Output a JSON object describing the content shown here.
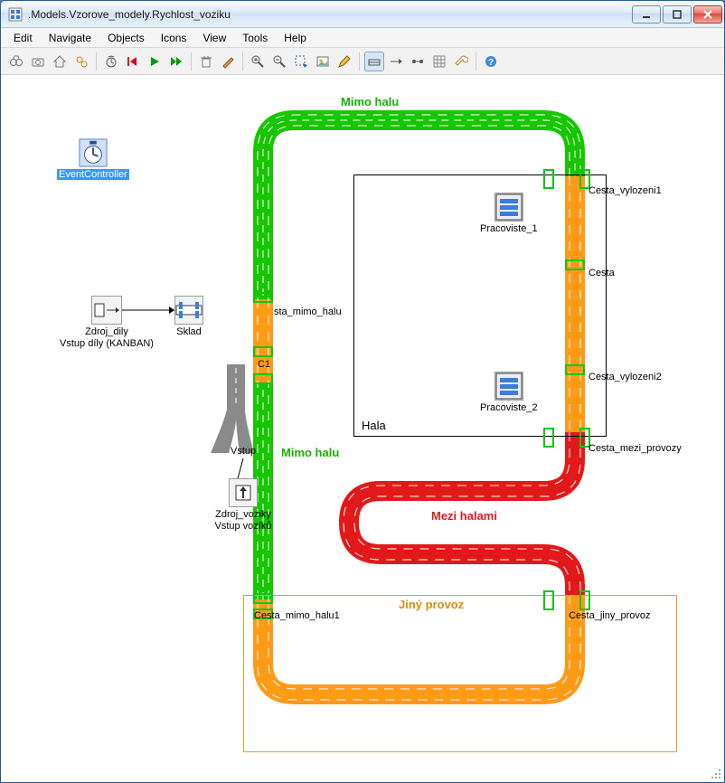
{
  "window": {
    "title": ".Models.Vzorove_modely.Rychlost_voziku"
  },
  "menu": {
    "edit": "Edit",
    "navigate": "Navigate",
    "objects": "Objects",
    "icons": "Icons",
    "view": "View",
    "tools": "Tools",
    "help": "Help"
  },
  "colors": {
    "green": "#17c600",
    "orange": "#ff9a17",
    "red": "#e31919"
  },
  "objects": {
    "event_controller": "EventController",
    "zdroj_dily": "Zdroj_dily\nVstup díly (KANBAN)",
    "sklad": "Sklad",
    "zdroj_voziky": "Zdroj_voziky\nVstup vozíků",
    "vstup": "Vstup",
    "pracoviste_1": "Pracoviste_1",
    "pracoviste_2": "Pracoviste_2",
    "hala_caption": "Hala"
  },
  "labels": {
    "sta_mimo_halu": "sta_mimo_halu",
    "c1": "C1",
    "cesta_vylozeni1": "Cesta_vylozeni1",
    "cesta": "Cesta",
    "cesta_vylozeni2": "Cesta_vylozeni2",
    "cesta_mezi_provozy": "Cesta_mezi_provozy",
    "cesta_mimo_halu1": "Cesta_mimo_halu1",
    "cesta_jiny_provoz": "Cesta_jiny_provoz",
    "mimo_halu_top": "Mimo halu",
    "mimo_halu_mid": "Mimo halu",
    "mezi_halami": "Mezi halami",
    "jiny_provoz": "Jiný provoz"
  }
}
